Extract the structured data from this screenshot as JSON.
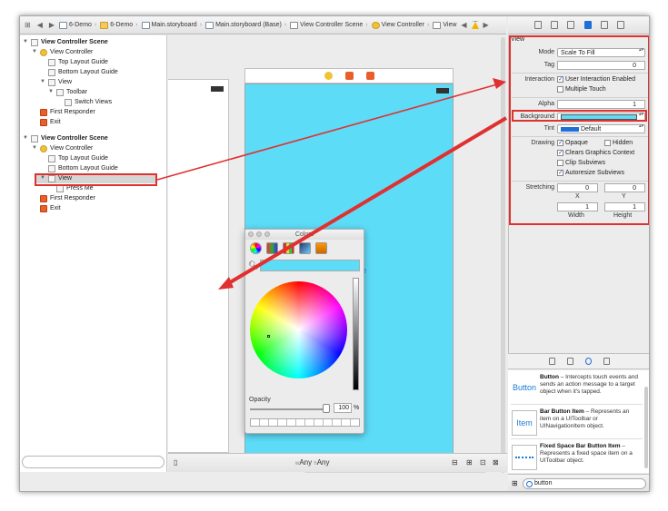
{
  "jumpbar": {
    "crumbs": [
      "6-Demo",
      "6-Demo",
      "Main.storyboard",
      "Main.storyboard (Base)",
      "View Controller Scene",
      "View Controller",
      "View"
    ]
  },
  "outline": {
    "rows": [
      {
        "label": "View Controller Scene",
        "bold": true,
        "icon": "scene-icon",
        "disclosure": "▼"
      },
      {
        "label": "View Controller",
        "icon": "view-controller-icon",
        "disclosure": "▼"
      },
      {
        "label": "Top Layout Guide",
        "icon": "layout-guide-icon"
      },
      {
        "label": "Bottom Layout Guide",
        "icon": "layout-guide-icon"
      },
      {
        "label": "View",
        "icon": "view-icon",
        "disclosure": "▼"
      },
      {
        "label": "Toolbar",
        "icon": "toolbar-icon",
        "disclosure": "▼"
      },
      {
        "label": "Switch Views",
        "icon": "bar-button-icon"
      },
      {
        "label": "First Responder",
        "icon": "first-responder-icon"
      },
      {
        "label": "Exit",
        "icon": "exit-icon"
      },
      {
        "label": "View Controller Scene",
        "bold": true,
        "icon": "scene-icon",
        "disclosure": "▼"
      },
      {
        "label": "View Controller",
        "icon": "view-controller-icon",
        "disclosure": "▼"
      },
      {
        "label": "Top Layout Guide",
        "icon": "layout-guide-icon"
      },
      {
        "label": "Bottom Layout Guide",
        "icon": "layout-guide-icon"
      },
      {
        "label": "View",
        "icon": "view-icon",
        "disclosure": "▼",
        "selected": true
      },
      {
        "label": "Press Me",
        "icon": "button-b-icon"
      },
      {
        "label": "First Responder",
        "icon": "first-responder-icon"
      },
      {
        "label": "Exit",
        "icon": "exit-icon"
      }
    ]
  },
  "canvas": {
    "button_label": "Press Me",
    "size_class": {
      "w": "w",
      "w_value": "Any",
      "h": "h",
      "h_value": "Any"
    },
    "background_color": "#5DDCF8"
  },
  "colors_panel": {
    "title": "Colors",
    "opacity_label": "Opacity",
    "opacity_value": "100",
    "opacity_unit": "%",
    "selected_color": "#5DDCF8"
  },
  "inspector": {
    "section": "View",
    "mode_label": "Mode",
    "mode_value": "Scale To Fill",
    "tag_label": "Tag",
    "tag_value": "0",
    "interaction_label": "Interaction",
    "user_interaction": "User Interaction Enabled",
    "multiple_touch": "Multiple Touch",
    "alpha_label": "Alpha",
    "alpha_value": "1",
    "background_label": "Background",
    "tint_label": "Tint",
    "tint_value": "Default",
    "drawing_label": "Drawing",
    "opaque": "Opaque",
    "hidden": "Hidden",
    "clears": "Clears Graphics Context",
    "clip": "Clip Subviews",
    "autoresize": "Autoresize Subviews",
    "stretching_label": "Stretching",
    "stretch_x": "0",
    "stretch_y": "0",
    "stretch_w": "1",
    "stretch_h": "1",
    "x_label": "X",
    "y_label": "Y",
    "width_label": "Width",
    "height_label": "Height"
  },
  "library": {
    "items": [
      {
        "icon_text": "Button",
        "title": "Button",
        "desc": " – Intercepts touch events and sends an action message to a target object when it's tapped."
      },
      {
        "icon_text": "Item",
        "title": "Bar Button Item",
        "desc": " – Represents an item on a UIToolbar or UINavigationItem object."
      },
      {
        "icon_text": "",
        "title": "Fixed Space Bar Button Item",
        "desc": " – Represents a fixed space item on a UIToolbar object."
      }
    ],
    "search_value": "button"
  },
  "colors": {
    "highlight": "#E03030",
    "accent": "#1F6FD8"
  }
}
